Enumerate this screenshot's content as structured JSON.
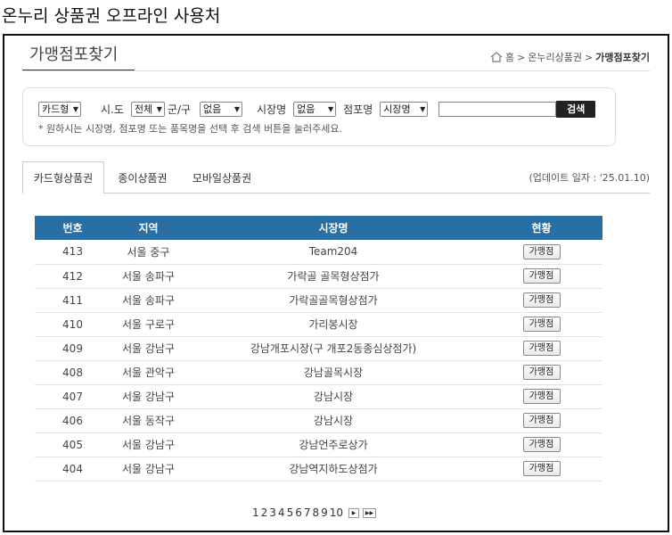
{
  "page_heading": "온누리 상품권 오프라인 사용처",
  "section_title": "가맹점포찾기",
  "breadcrumb": {
    "home": "홈",
    "sep": ">",
    "parent": "온누리상품권",
    "current": "가맹점포찾기"
  },
  "search": {
    "card_type_select": "카드형",
    "sido_label": "시.도",
    "sido_select": "전체",
    "gungu_label": "군/구",
    "gungu_select": "없음",
    "market_label": "시장명",
    "market_select": "없음",
    "store_label": "점포명",
    "store_select": "시장명",
    "button": "검색",
    "hint": "* 원하시는 시장명, 점포명 또는 품목명을 선택 후 검색 버튼을 눌러주세요."
  },
  "tabs": [
    {
      "label": "카드형상품권",
      "active": true
    },
    {
      "label": "종이상품권",
      "active": false
    },
    {
      "label": "모바일상품권",
      "active": false
    }
  ],
  "update_date": "(업데이트 일자 : '25.01.10)",
  "table": {
    "headers": {
      "no": "번호",
      "region": "지역",
      "market": "시장명",
      "status": "현황"
    },
    "rows": [
      {
        "no": "413",
        "region": "서울 중구",
        "market": "Team204",
        "status": "가맹점"
      },
      {
        "no": "412",
        "region": "서울 송파구",
        "market": "가락골 골목형상점가",
        "status": "가맹점"
      },
      {
        "no": "411",
        "region": "서울 송파구",
        "market": "가락골골목형상점가",
        "status": "가맹점"
      },
      {
        "no": "410",
        "region": "서울 구로구",
        "market": "가리봉시장",
        "status": "가맹점"
      },
      {
        "no": "409",
        "region": "서울 강남구",
        "market": "강남개포시장(구 개포2동종심상점가)",
        "status": "가맹점"
      },
      {
        "no": "408",
        "region": "서울 관악구",
        "market": "강남골목시장",
        "status": "가맹점"
      },
      {
        "no": "407",
        "region": "서울 강남구",
        "market": "강남시장",
        "status": "가맹점"
      },
      {
        "no": "406",
        "region": "서울 동작구",
        "market": "강남시장",
        "status": "가맹점"
      },
      {
        "no": "405",
        "region": "서울 강남구",
        "market": "강남언주로상가",
        "status": "가맹점"
      },
      {
        "no": "404",
        "region": "서울 강남구",
        "market": "강남역지하도상점가",
        "status": "가맹점"
      }
    ]
  },
  "pagination": {
    "pages": [
      "1",
      "2",
      "3",
      "4",
      "5",
      "6",
      "7",
      "8",
      "9",
      "10"
    ],
    "next": "▶",
    "last": "▶▶"
  },
  "colors": {
    "table_header": "#2a6fa3",
    "search_button": "#222222"
  }
}
